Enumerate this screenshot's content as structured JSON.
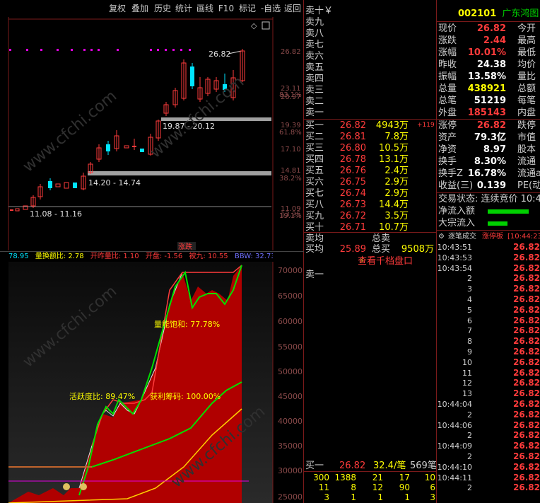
{
  "toolbar": {
    "buttons": [
      "复权",
      "叠加",
      "历史",
      "统计",
      "画线",
      "F10",
      "标记",
      "-自选",
      "返回"
    ]
  },
  "kline": {
    "price_labels": [
      "26.82",
      "23.11",
      "20.97",
      "19.39",
      "17.10",
      "14.81",
      "13.25",
      "11.09"
    ],
    "pct_labels": [
      "83.1%",
      "61.8%",
      "38.2%",
      "19.1%"
    ],
    "band_labels": [
      "19.87 - 20.12",
      "14.20 - 14.74",
      "11.08 - 11.16"
    ],
    "high_label": "26.82",
    "strip_label": "涨跌"
  },
  "indicator_bar": {
    "items": [
      {
        "text": "78.95",
        "color": "#00e5ff"
      },
      {
        "text": "量换额比: 2.78",
        "color": "#ffff00"
      },
      {
        "text": "开昨量比: 1.10",
        "color": "#ff3b3b"
      },
      {
        "text": "开盘: -1.56",
        "color": "#ff3b3b"
      },
      {
        "text": "被九: 10.55",
        "color": "#ff3b3b"
      },
      {
        "text": "BBW: 32.73",
        "color": "#7070ff"
      }
    ]
  },
  "chip": {
    "y_labels": [
      "70000",
      "65000",
      "60000",
      "55000",
      "50000",
      "45000",
      "40000",
      "35000",
      "30000",
      "25000"
    ],
    "annot_saturation": "量能饱和: 77.78%",
    "annot_activity": "活跃度比: 89.47%",
    "annot_profit": "获利筹码: 100.00%"
  },
  "orderbook": {
    "sell_labels": [
      "卖十￥",
      "卖九",
      "卖八",
      "卖七",
      "卖六",
      "卖五",
      "卖四",
      "卖三",
      "卖二",
      "卖一"
    ],
    "buy": [
      {
        "label": "买一",
        "price": "26.82",
        "vol": "4943万",
        "chg": "+119"
      },
      {
        "label": "买二",
        "price": "26.81",
        "vol": "7.8万",
        "chg": ""
      },
      {
        "label": "买三",
        "price": "26.80",
        "vol": "10.5万",
        "chg": ""
      },
      {
        "label": "买四",
        "price": "26.78",
        "vol": "13.1万",
        "chg": ""
      },
      {
        "label": "买五",
        "price": "26.76",
        "vol": "2.4万",
        "chg": ""
      },
      {
        "label": "买六",
        "price": "26.75",
        "vol": "2.9万",
        "chg": ""
      },
      {
        "label": "买七",
        "price": "26.74",
        "vol": "2.9万",
        "chg": ""
      },
      {
        "label": "买八",
        "price": "26.73",
        "vol": "14.4万",
        "chg": ""
      },
      {
        "label": "买九",
        "price": "26.72",
        "vol": "3.5万",
        "chg": ""
      },
      {
        "label": "买十",
        "price": "26.71",
        "vol": "10.7万",
        "chg": ""
      }
    ],
    "avg_sell_label": "卖均",
    "total_sell_label": "总卖",
    "avg_buy_label": "买均",
    "avg_buy_value": "25.89",
    "total_buy_label": "总买",
    "total_buy_value": "9508万",
    "link_text": "查看千档盘口",
    "queue_sell": "卖一",
    "queue_buy": {
      "label": "买一",
      "price": "26.82",
      "avg": "32.4/笔",
      "count": "569笔"
    },
    "queue_rows": [
      [
        "300",
        "1388",
        "21",
        "17",
        "10"
      ],
      [
        "11",
        "8",
        "12",
        "90",
        "6"
      ],
      [
        "3",
        "1",
        "1",
        "1",
        "3"
      ]
    ]
  },
  "quote": {
    "code": "002101",
    "name": "广东鸿图",
    "rows": [
      {
        "label": "现价",
        "value": "26.82",
        "vcolor": "#ff3b3b",
        "label2": "今开"
      },
      {
        "label": "涨跌",
        "value": "2.44",
        "vcolor": "#ff3b3b",
        "label2": "最高"
      },
      {
        "label": "涨幅",
        "value": "10.01%",
        "vcolor": "#ff3b3b",
        "label2": "最低"
      },
      {
        "label": "昨收",
        "value": "24.38",
        "vcolor": "#ffffff",
        "label2": "均价"
      },
      {
        "label": "振幅",
        "value": "13.58%",
        "vcolor": "#ffffff",
        "label2": "量比"
      },
      {
        "label": "总量",
        "value": "438921",
        "vcolor": "#ffff00",
        "label2": "总额"
      },
      {
        "label": "总笔",
        "value": "51219",
        "vcolor": "#ffffff",
        "label2": "每笔"
      },
      {
        "label": "外盘",
        "value": "185143",
        "vcolor": "#ff3b3b",
        "label2": "内盘"
      }
    ],
    "rows2": [
      {
        "label": "涨停",
        "value": "26.82",
        "vcolor": "#ff3b3b",
        "label2": "跌停"
      },
      {
        "label": "资产",
        "value": "79.3亿",
        "vcolor": "#ffffff",
        "label2": "市值"
      },
      {
        "label": "净资",
        "value": "8.97",
        "vcolor": "#ffffff",
        "label2": "股本"
      },
      {
        "label": "换手",
        "value": "8.30%",
        "vcolor": "#ffffff",
        "label2": "流通"
      },
      {
        "label": "换手Z",
        "value": "16.78%",
        "vcolor": "#ffffff",
        "label2": "流通a"
      },
      {
        "label": "收益(三)",
        "value": "0.139",
        "vcolor": "#ffffff",
        "label2": "PE(动)"
      }
    ],
    "trade_state": "交易状态: 连续竞价 10:4",
    "net_inflow": "净流入额",
    "big_inflow": "大宗流入",
    "ticks_title": "逐笔成交",
    "ticks_tab": "涨停板",
    "ticks_time": "[10:44:23",
    "ticks": [
      {
        "t": "10:43:51",
        "p": "26.82"
      },
      {
        "t": "10:43:53",
        "p": "26.82"
      },
      {
        "t": "10:43:54",
        "p": "26.82"
      },
      {
        "t": "2",
        "p": "26.82"
      },
      {
        "t": "3",
        "p": "26.82"
      },
      {
        "t": "4",
        "p": "26.82"
      },
      {
        "t": "5",
        "p": "26.82"
      },
      {
        "t": "6",
        "p": "26.82"
      },
      {
        "t": "7",
        "p": "26.82"
      },
      {
        "t": "8",
        "p": "26.82"
      },
      {
        "t": "9",
        "p": "26.82"
      },
      {
        "t": "10",
        "p": "26.82"
      },
      {
        "t": "11",
        "p": "26.82"
      },
      {
        "t": "12",
        "p": "26.82"
      },
      {
        "t": "13",
        "p": "26.82"
      },
      {
        "t": "10:44:04",
        "p": "26.82"
      },
      {
        "t": "2",
        "p": "26.82"
      },
      {
        "t": "10:44:06",
        "p": "26.82"
      },
      {
        "t": "2",
        "p": "26.82"
      },
      {
        "t": "10:44:09",
        "p": "26.82"
      },
      {
        "t": "2",
        "p": "26.82"
      },
      {
        "t": "10:44:10",
        "p": "26.82"
      },
      {
        "t": "10:44:11",
        "p": "26.82"
      },
      {
        "t": "2",
        "p": "26.82"
      }
    ]
  }
}
